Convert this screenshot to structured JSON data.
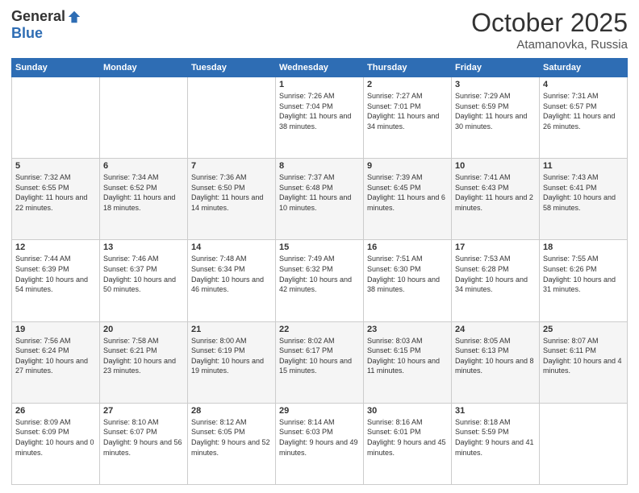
{
  "header": {
    "logo_general": "General",
    "logo_blue": "Blue",
    "month_title": "October 2025",
    "location": "Atamanovka, Russia"
  },
  "days_of_week": [
    "Sunday",
    "Monday",
    "Tuesday",
    "Wednesday",
    "Thursday",
    "Friday",
    "Saturday"
  ],
  "weeks": [
    [
      {
        "day": "",
        "sunrise": "",
        "sunset": "",
        "daylight": ""
      },
      {
        "day": "",
        "sunrise": "",
        "sunset": "",
        "daylight": ""
      },
      {
        "day": "",
        "sunrise": "",
        "sunset": "",
        "daylight": ""
      },
      {
        "day": "1",
        "sunrise": "Sunrise: 7:26 AM",
        "sunset": "Sunset: 7:04 PM",
        "daylight": "Daylight: 11 hours and 38 minutes."
      },
      {
        "day": "2",
        "sunrise": "Sunrise: 7:27 AM",
        "sunset": "Sunset: 7:01 PM",
        "daylight": "Daylight: 11 hours and 34 minutes."
      },
      {
        "day": "3",
        "sunrise": "Sunrise: 7:29 AM",
        "sunset": "Sunset: 6:59 PM",
        "daylight": "Daylight: 11 hours and 30 minutes."
      },
      {
        "day": "4",
        "sunrise": "Sunrise: 7:31 AM",
        "sunset": "Sunset: 6:57 PM",
        "daylight": "Daylight: 11 hours and 26 minutes."
      }
    ],
    [
      {
        "day": "5",
        "sunrise": "Sunrise: 7:32 AM",
        "sunset": "Sunset: 6:55 PM",
        "daylight": "Daylight: 11 hours and 22 minutes."
      },
      {
        "day": "6",
        "sunrise": "Sunrise: 7:34 AM",
        "sunset": "Sunset: 6:52 PM",
        "daylight": "Daylight: 11 hours and 18 minutes."
      },
      {
        "day": "7",
        "sunrise": "Sunrise: 7:36 AM",
        "sunset": "Sunset: 6:50 PM",
        "daylight": "Daylight: 11 hours and 14 minutes."
      },
      {
        "day": "8",
        "sunrise": "Sunrise: 7:37 AM",
        "sunset": "Sunset: 6:48 PM",
        "daylight": "Daylight: 11 hours and 10 minutes."
      },
      {
        "day": "9",
        "sunrise": "Sunrise: 7:39 AM",
        "sunset": "Sunset: 6:45 PM",
        "daylight": "Daylight: 11 hours and 6 minutes."
      },
      {
        "day": "10",
        "sunrise": "Sunrise: 7:41 AM",
        "sunset": "Sunset: 6:43 PM",
        "daylight": "Daylight: 11 hours and 2 minutes."
      },
      {
        "day": "11",
        "sunrise": "Sunrise: 7:43 AM",
        "sunset": "Sunset: 6:41 PM",
        "daylight": "Daylight: 10 hours and 58 minutes."
      }
    ],
    [
      {
        "day": "12",
        "sunrise": "Sunrise: 7:44 AM",
        "sunset": "Sunset: 6:39 PM",
        "daylight": "Daylight: 10 hours and 54 minutes."
      },
      {
        "day": "13",
        "sunrise": "Sunrise: 7:46 AM",
        "sunset": "Sunset: 6:37 PM",
        "daylight": "Daylight: 10 hours and 50 minutes."
      },
      {
        "day": "14",
        "sunrise": "Sunrise: 7:48 AM",
        "sunset": "Sunset: 6:34 PM",
        "daylight": "Daylight: 10 hours and 46 minutes."
      },
      {
        "day": "15",
        "sunrise": "Sunrise: 7:49 AM",
        "sunset": "Sunset: 6:32 PM",
        "daylight": "Daylight: 10 hours and 42 minutes."
      },
      {
        "day": "16",
        "sunrise": "Sunrise: 7:51 AM",
        "sunset": "Sunset: 6:30 PM",
        "daylight": "Daylight: 10 hours and 38 minutes."
      },
      {
        "day": "17",
        "sunrise": "Sunrise: 7:53 AM",
        "sunset": "Sunset: 6:28 PM",
        "daylight": "Daylight: 10 hours and 34 minutes."
      },
      {
        "day": "18",
        "sunrise": "Sunrise: 7:55 AM",
        "sunset": "Sunset: 6:26 PM",
        "daylight": "Daylight: 10 hours and 31 minutes."
      }
    ],
    [
      {
        "day": "19",
        "sunrise": "Sunrise: 7:56 AM",
        "sunset": "Sunset: 6:24 PM",
        "daylight": "Daylight: 10 hours and 27 minutes."
      },
      {
        "day": "20",
        "sunrise": "Sunrise: 7:58 AM",
        "sunset": "Sunset: 6:21 PM",
        "daylight": "Daylight: 10 hours and 23 minutes."
      },
      {
        "day": "21",
        "sunrise": "Sunrise: 8:00 AM",
        "sunset": "Sunset: 6:19 PM",
        "daylight": "Daylight: 10 hours and 19 minutes."
      },
      {
        "day": "22",
        "sunrise": "Sunrise: 8:02 AM",
        "sunset": "Sunset: 6:17 PM",
        "daylight": "Daylight: 10 hours and 15 minutes."
      },
      {
        "day": "23",
        "sunrise": "Sunrise: 8:03 AM",
        "sunset": "Sunset: 6:15 PM",
        "daylight": "Daylight: 10 hours and 11 minutes."
      },
      {
        "day": "24",
        "sunrise": "Sunrise: 8:05 AM",
        "sunset": "Sunset: 6:13 PM",
        "daylight": "Daylight: 10 hours and 8 minutes."
      },
      {
        "day": "25",
        "sunrise": "Sunrise: 8:07 AM",
        "sunset": "Sunset: 6:11 PM",
        "daylight": "Daylight: 10 hours and 4 minutes."
      }
    ],
    [
      {
        "day": "26",
        "sunrise": "Sunrise: 8:09 AM",
        "sunset": "Sunset: 6:09 PM",
        "daylight": "Daylight: 10 hours and 0 minutes."
      },
      {
        "day": "27",
        "sunrise": "Sunrise: 8:10 AM",
        "sunset": "Sunset: 6:07 PM",
        "daylight": "Daylight: 9 hours and 56 minutes."
      },
      {
        "day": "28",
        "sunrise": "Sunrise: 8:12 AM",
        "sunset": "Sunset: 6:05 PM",
        "daylight": "Daylight: 9 hours and 52 minutes."
      },
      {
        "day": "29",
        "sunrise": "Sunrise: 8:14 AM",
        "sunset": "Sunset: 6:03 PM",
        "daylight": "Daylight: 9 hours and 49 minutes."
      },
      {
        "day": "30",
        "sunrise": "Sunrise: 8:16 AM",
        "sunset": "Sunset: 6:01 PM",
        "daylight": "Daylight: 9 hours and 45 minutes."
      },
      {
        "day": "31",
        "sunrise": "Sunrise: 8:18 AM",
        "sunset": "Sunset: 5:59 PM",
        "daylight": "Daylight: 9 hours and 41 minutes."
      },
      {
        "day": "",
        "sunrise": "",
        "sunset": "",
        "daylight": ""
      }
    ]
  ]
}
